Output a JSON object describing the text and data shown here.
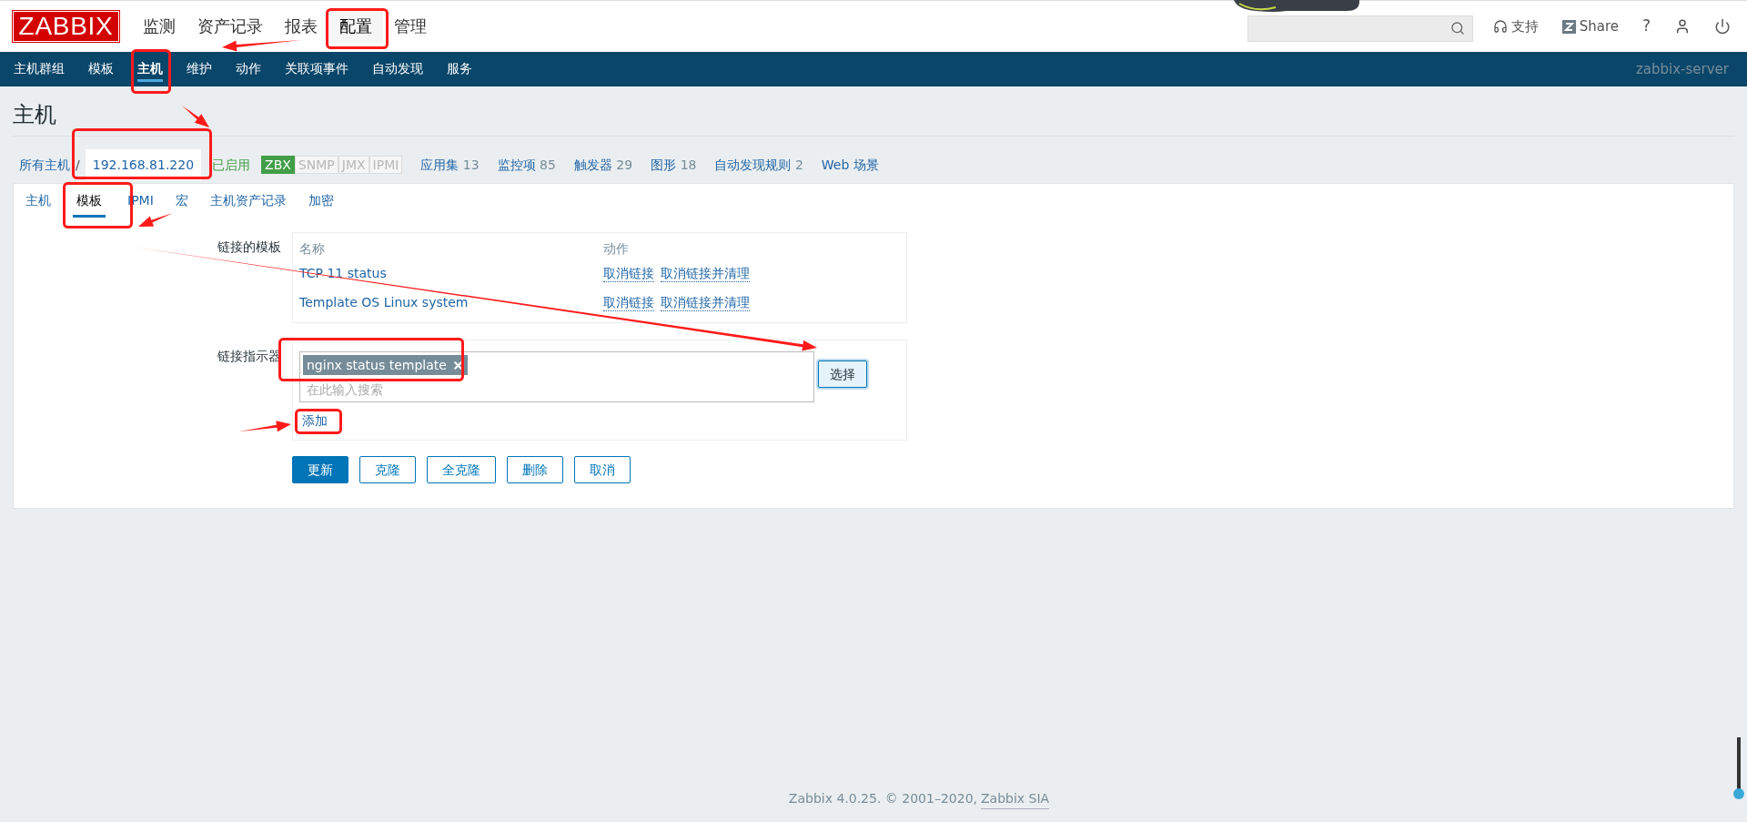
{
  "logo": "ZABBIX",
  "main_menu": [
    {
      "label": "监测",
      "selected": false
    },
    {
      "label": "资产记录",
      "selected": false
    },
    {
      "label": "报表",
      "selected": false
    },
    {
      "label": "配置",
      "selected": true
    },
    {
      "label": "管理",
      "selected": false
    }
  ],
  "header_links": [
    {
      "kind": "support",
      "label": "支持"
    },
    {
      "kind": "share",
      "label": "Share"
    },
    {
      "kind": "help",
      "label": "?"
    },
    {
      "kind": "user"
    },
    {
      "kind": "power"
    }
  ],
  "sub_menu": [
    {
      "label": "主机群组",
      "selected": false
    },
    {
      "label": "模板",
      "selected": false
    },
    {
      "label": "主机",
      "selected": true
    },
    {
      "label": "维护",
      "selected": false
    },
    {
      "label": "动作",
      "selected": false
    },
    {
      "label": "关联项事件",
      "selected": false
    },
    {
      "label": "自动发现",
      "selected": false
    },
    {
      "label": "服务",
      "selected": false
    }
  ],
  "server_name": "zabbix-server",
  "page_title": "主机",
  "breadcrumb": {
    "root": "所有主机",
    "separator": "/",
    "current": "192.168.81.220",
    "status": "已启用"
  },
  "interfaces": [
    {
      "label": "ZBX",
      "on": true
    },
    {
      "label": "SNMP",
      "on": false
    },
    {
      "label": "JMX",
      "on": false
    },
    {
      "label": "IPMI",
      "on": false
    }
  ],
  "host_links": [
    {
      "label": "应用集",
      "count": "13"
    },
    {
      "label": "监控项",
      "count": "85"
    },
    {
      "label": "触发器",
      "count": "29"
    },
    {
      "label": "图形",
      "count": "18"
    },
    {
      "label": "自动发现规则",
      "count": "2"
    },
    {
      "label": "Web 场景"
    }
  ],
  "tabs": [
    {
      "label": "主机",
      "selected": false
    },
    {
      "label": "模板",
      "selected": true
    },
    {
      "label": "IPMI",
      "selected": false
    },
    {
      "label": "宏",
      "selected": false
    },
    {
      "label": "主机资产记录",
      "selected": false
    },
    {
      "label": "加密",
      "selected": false
    }
  ],
  "linked_templates": {
    "label": "链接的模板",
    "columns": [
      "名称",
      "动作"
    ],
    "rows": [
      {
        "name": "TCP 11 status",
        "actions": [
          "取消链接",
          "取消链接并清理"
        ]
      },
      {
        "name": "Template OS Linux system",
        "actions": [
          "取消链接",
          "取消链接并清理"
        ]
      }
    ]
  },
  "link_new": {
    "label": "链接指示器",
    "chips": [
      "nginx status template"
    ],
    "placeholder": "在此输入搜索",
    "select_button": "选择",
    "add_link": "添加"
  },
  "buttons": [
    {
      "label": "更新",
      "kind": "primary"
    },
    {
      "label": "克隆",
      "kind": "secondary"
    },
    {
      "label": "全克隆",
      "kind": "secondary"
    },
    {
      "label": "删除",
      "kind": "secondary"
    },
    {
      "label": "取消",
      "kind": "secondary"
    }
  ],
  "footer": {
    "text": "Zabbix 4.0.25. © 2001–2020,",
    "link": "Zabbix SIA"
  }
}
